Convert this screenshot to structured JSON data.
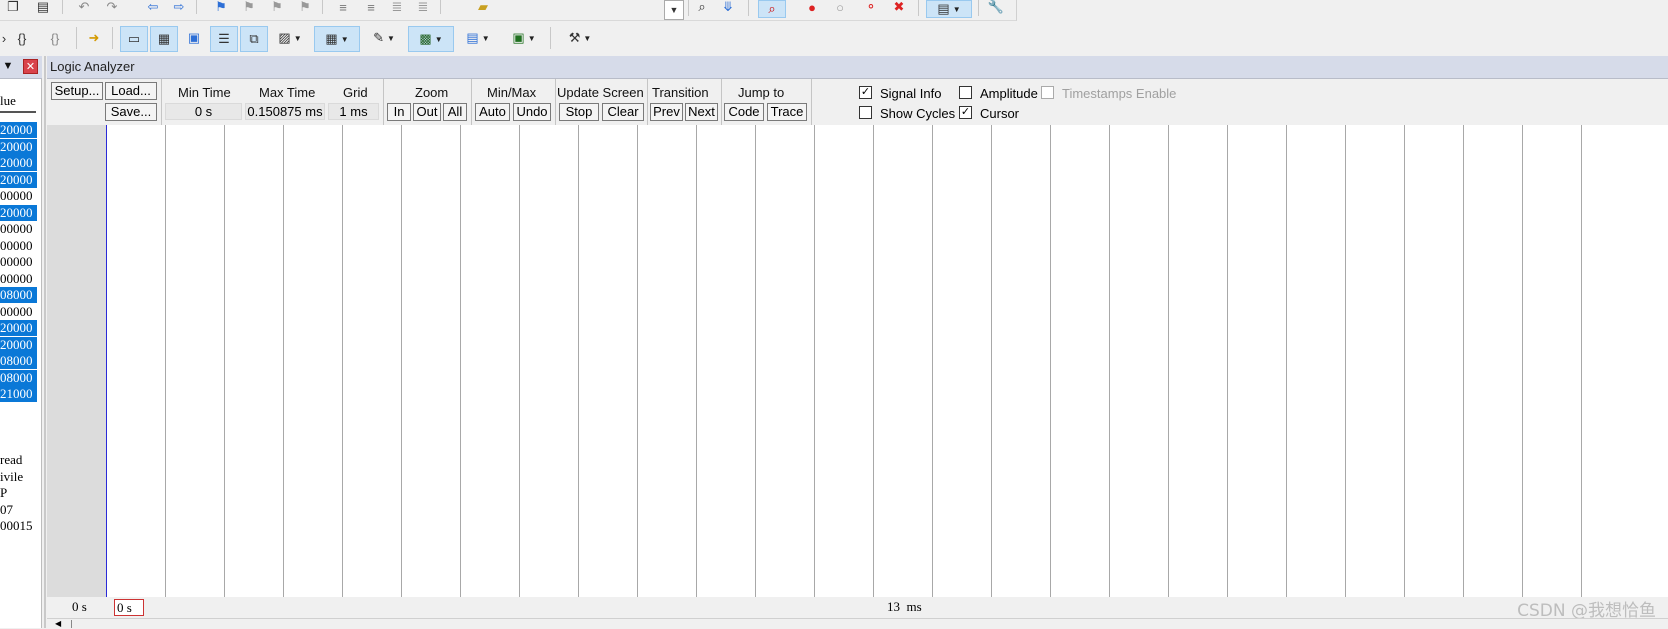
{
  "panel": {
    "title": "Logic Analyzer",
    "pin_icon": "pin-icon",
    "close_icon": "close-icon"
  },
  "left_panel": {
    "column_header": "lue",
    "values": [
      {
        "text": "20000",
        "highlighted": true
      },
      {
        "text": "20000",
        "highlighted": true
      },
      {
        "text": "20000",
        "highlighted": true
      },
      {
        "text": "20000",
        "highlighted": true
      },
      {
        "text": "00000",
        "highlighted": false
      },
      {
        "text": "20000",
        "highlighted": true
      },
      {
        "text": "00000",
        "highlighted": false
      },
      {
        "text": "00000",
        "highlighted": false
      },
      {
        "text": "00000",
        "highlighted": false
      },
      {
        "text": "00000",
        "highlighted": false
      },
      {
        "text": "08000",
        "highlighted": true
      },
      {
        "text": "00000",
        "highlighted": false
      },
      {
        "text": "20000",
        "highlighted": true
      },
      {
        "text": "20000",
        "highlighted": true
      },
      {
        "text": "08000",
        "highlighted": true
      },
      {
        "text": "08000",
        "highlighted": true
      },
      {
        "text": "21000",
        "highlighted": true
      }
    ],
    "extra_lines": [
      "read",
      "ivile",
      "P",
      "07",
      "00015"
    ]
  },
  "controls": {
    "setup": "Setup...",
    "load": "Load...",
    "save": "Save...",
    "min_time_label": "Min Time",
    "min_time_value": "0 s",
    "max_time_label": "Max Time",
    "max_time_value": "0.150875 ms",
    "grid_label": "Grid",
    "grid_value": "1 ms",
    "zoom_label": "Zoom",
    "zoom_in": "In",
    "zoom_out": "Out",
    "zoom_all": "All",
    "minmax_label": "Min/Max",
    "auto": "Auto",
    "undo": "Undo",
    "update_screen_label": "Update Screen",
    "stop": "Stop",
    "clear": "Clear",
    "transition_label": "Transition",
    "prev": "Prev",
    "next": "Next",
    "jump_to_label": "Jump to",
    "code": "Code",
    "trace": "Trace"
  },
  "checkboxes": {
    "signal_info": {
      "label": "Signal Info",
      "checked": true
    },
    "show_cycles": {
      "label": "Show Cycles",
      "checked": false
    },
    "amplitude": {
      "label": "Amplitude",
      "checked": false
    },
    "cursor": {
      "label": "Cursor",
      "checked": true
    },
    "timestamps": {
      "label": "Timestamps Enable",
      "checked": false,
      "disabled": true
    }
  },
  "timeline": {
    "start": "0 s",
    "cursor": "0 s",
    "mid": "13  ms"
  },
  "watermark": "CSDN @我想恰鱼",
  "colors": {
    "highlight": "#0a78d7",
    "cursor_line": "#2a2ad8",
    "panel_title_bg": "#d6dbe9"
  },
  "toolbar_icons": {
    "row1": [
      "copy-icon",
      "paste-icon",
      "undo-icon",
      "redo-icon",
      "nav-back-icon",
      "nav-forward-icon",
      "bookmark-icon",
      "bookmark-prev-icon",
      "bookmark-next-icon",
      "bookmark-clear-icon",
      "indent-icon",
      "unindent-icon",
      "comment-icon",
      "uncomment-icon",
      "open-file-icon",
      "dropdown-icon",
      "find-icon",
      "find-in-files-icon",
      "debug-session-icon",
      "breakpoint-icon",
      "breakpoint-disable-icon",
      "breakpoint-disable-all-icon",
      "breakpoint-kill-icon",
      "window-layout-icon",
      "settings-wrench-icon"
    ],
    "row2": [
      "step-over-icon",
      "step-out-icon",
      "run-to-cursor-icon",
      "show-next-statement-icon",
      "command-window-icon",
      "disassembly-window-icon",
      "symbols-window-icon",
      "registers-window-icon",
      "call-stack-icon",
      "watch-window-icon",
      "memory-window-icon",
      "serial-window-icon",
      "analysis-window-icon",
      "trace-window-icon",
      "system-viewer-icon",
      "toolbox-icon"
    ]
  }
}
